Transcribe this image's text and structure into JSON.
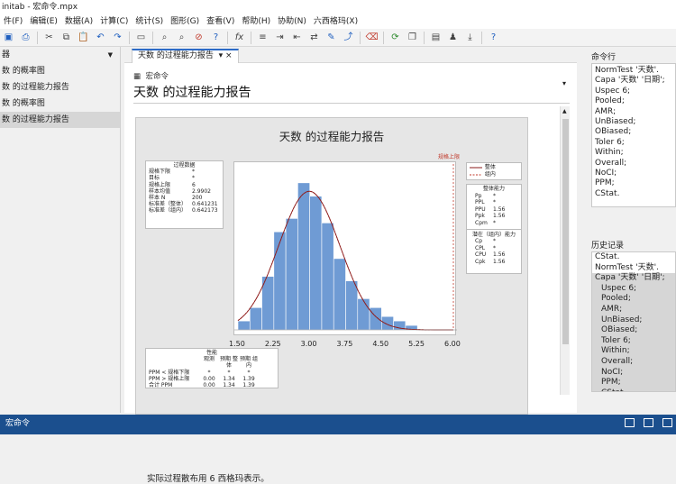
{
  "window": {
    "title": "initab - 宏命令.mpx"
  },
  "menu": [
    "件(F)",
    "编辑(E)",
    "数据(A)",
    "计算(C)",
    "统计(S)",
    "图形(G)",
    "查看(V)",
    "帮助(H)",
    "协助(N)",
    "六西格玛(X)"
  ],
  "left_panel": {
    "header": "器",
    "items": [
      "数 的概率图",
      "数 的过程能力报告",
      "数 的概率图",
      "数 的过程能力报告"
    ]
  },
  "doc": {
    "tab_label": "天数 的过程能力报告",
    "tab_pin": "▾",
    "tab_close": "×",
    "crumb": "宏命令",
    "title": "天数 的过程能力报告",
    "menu_arrow": "▾",
    "note": "实际过程散布用 6 西格玛表示。"
  },
  "report": {
    "title": "天数 的过程能力报告",
    "spec_label": "规格上限",
    "process_data": {
      "header": "过程数据",
      "rows": [
        {
          "k": "规格下限",
          "v": "*"
        },
        {
          "k": "目标",
          "v": "*"
        },
        {
          "k": "规格上限",
          "v": "6"
        },
        {
          "k": "样本均值",
          "v": "2.9902"
        },
        {
          "k": "样本 N",
          "v": "200"
        },
        {
          "k": "标准差（整体）",
          "v": "0.641231"
        },
        {
          "k": "标准差（组内）",
          "v": "0.642173"
        }
      ]
    },
    "legend": {
      "overall": "整体",
      "within": "组内"
    },
    "overall_capability": {
      "header": "整体能力",
      "rows": [
        {
          "k": "Pp",
          "v": "*"
        },
        {
          "k": "PPL",
          "v": "*"
        },
        {
          "k": "PPU",
          "v": "1.56"
        },
        {
          "k": "Ppk",
          "v": "1.56"
        },
        {
          "k": "Cpm",
          "v": "*"
        }
      ]
    },
    "within_capability": {
      "header": "潜在（组内）能力",
      "rows": [
        {
          "k": "Cp",
          "v": "*"
        },
        {
          "k": "CPL",
          "v": "*"
        },
        {
          "k": "CPU",
          "v": "1.56"
        },
        {
          "k": "Cpk",
          "v": "1.56"
        }
      ]
    },
    "performance": {
      "header": "性能",
      "cols": [
        "观测",
        "预期 整体",
        "预期 组内"
      ],
      "rows": [
        {
          "k": "PPM < 规格下限",
          "v": [
            "*",
            "*",
            "*"
          ]
        },
        {
          "k": "PPM > 规格上限",
          "v": [
            "0.00",
            "1.34",
            "1.39"
          ]
        },
        {
          "k": "合计 PPM",
          "v": [
            "0.00",
            "1.34",
            "1.39"
          ]
        }
      ]
    },
    "x_ticks": [
      "1.50",
      "2.25",
      "3.00",
      "3.75",
      "4.50",
      "5.25",
      "6.00"
    ]
  },
  "chart_data": {
    "type": "bar",
    "xlim": [
      1.5,
      6.0
    ],
    "bin_width": 0.25,
    "bins_start": 1.625,
    "values": [
      2,
      5,
      12,
      22,
      25,
      33,
      30,
      24,
      16,
      11,
      7,
      5,
      3,
      2,
      1
    ],
    "usl": 6,
    "mean": 2.9902,
    "sd_overall": 0.641231,
    "sd_within": 0.642173,
    "colors": {
      "bars": "#6f9bd4",
      "overall": "#8b1a1a",
      "within": "#c0392b"
    }
  },
  "command_pane": {
    "header": "命令行",
    "lines": [
      "NormTest '天数'.",
      "Capa '天数' '日期';",
      "Uspec 6;",
      "Pooled;",
      "AMR;",
      "UnBiased;",
      "OBiased;",
      "Toler 6;",
      "Within;",
      "Overall;",
      "NoCI;",
      "PPM;",
      "CStat."
    ]
  },
  "history": {
    "header": "历史记录",
    "lines": [
      "CStat.",
      "NormTest '天数'.",
      "Capa '天数' '日期';",
      "Uspec 6;",
      "Pooled;",
      "AMR;",
      "UnBiased;",
      "OBiased;",
      "Toler 6;",
      "Within;",
      "Overall;",
      "NoCI;",
      "PPM;",
      "CStat."
    ]
  },
  "status": {
    "label": "宏命令"
  }
}
